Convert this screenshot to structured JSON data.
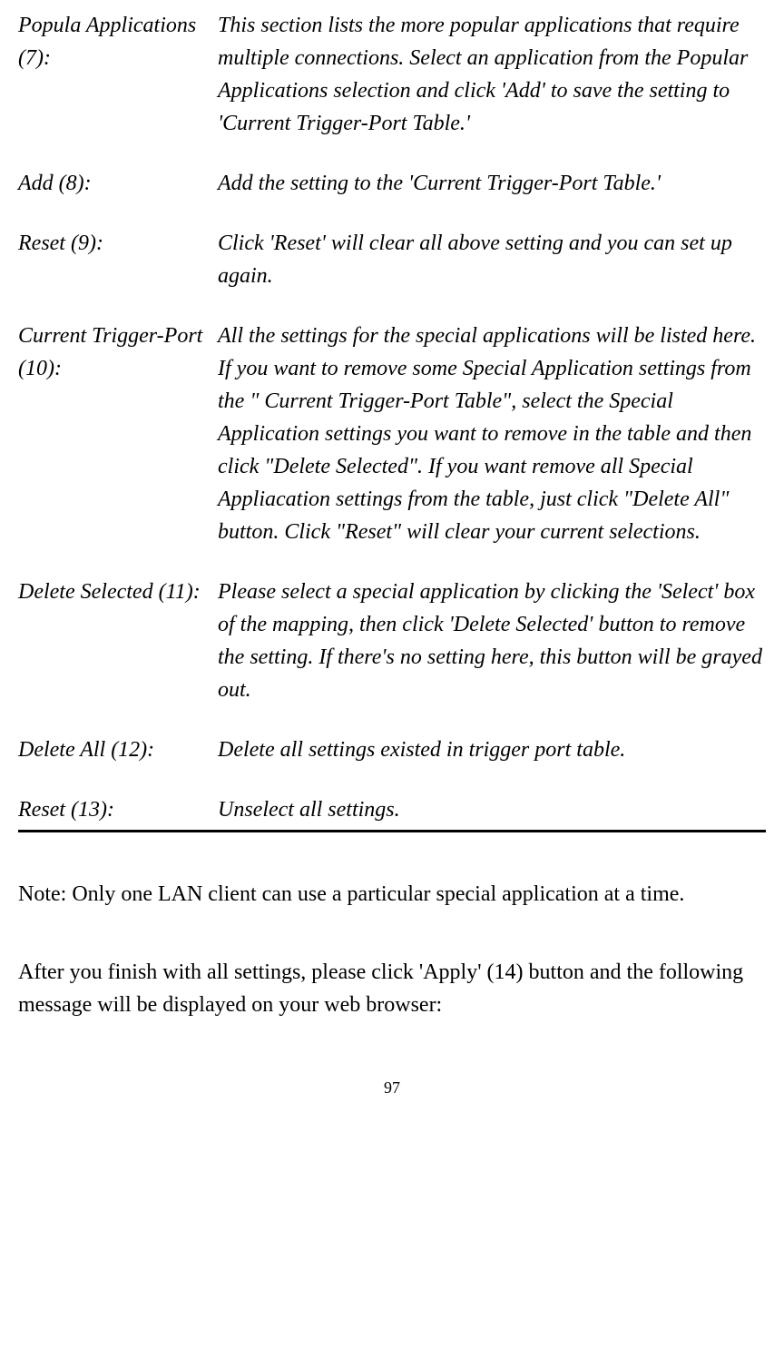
{
  "definitions": [
    {
      "term": "Popula Applications (7):",
      "desc": "This section lists the more popular applications that require multiple connections. Select an application from the Popular Applications selection and click 'Add' to save the setting to 'Current Trigger-Port Table.'"
    },
    {
      "term": "Add (8):",
      "desc": "Add the setting to the 'Current Trigger-Port Table.'"
    },
    {
      "term": "Reset (9):",
      "desc": "Click 'Reset' will clear all above setting and you can set up again."
    },
    {
      "term": "Current Trigger-Port (10):",
      "desc": "All the settings for the special applications will be listed here. If you want to remove some Special Application settings from the \" Current Trigger-Port Table\", select the Special Application settings you want to remove in the table and then click \"Delete Selected\". If you want remove all Special Appliacation settings from the table, just click \"Delete All\" button. Click \"Reset\" will clear your current selections."
    },
    {
      "term": "Delete Selected (11):",
      "desc": "Please select a special application by clicking the 'Select' box of the mapping, then click 'Delete Selected' button to remove the setting. If there's no setting here, this button will be grayed out."
    },
    {
      "term": "Delete All (12):",
      "desc": "Delete all settings existed in trigger port table."
    },
    {
      "term": "Reset (13):",
      "desc": "Unselect all settings."
    }
  ],
  "note": "Note: Only one LAN client can use a particular special application at a time.",
  "after": "After you finish with all settings, please click 'Apply' (14) button and the following message will be displayed on your web browser:",
  "pageNumber": "97"
}
